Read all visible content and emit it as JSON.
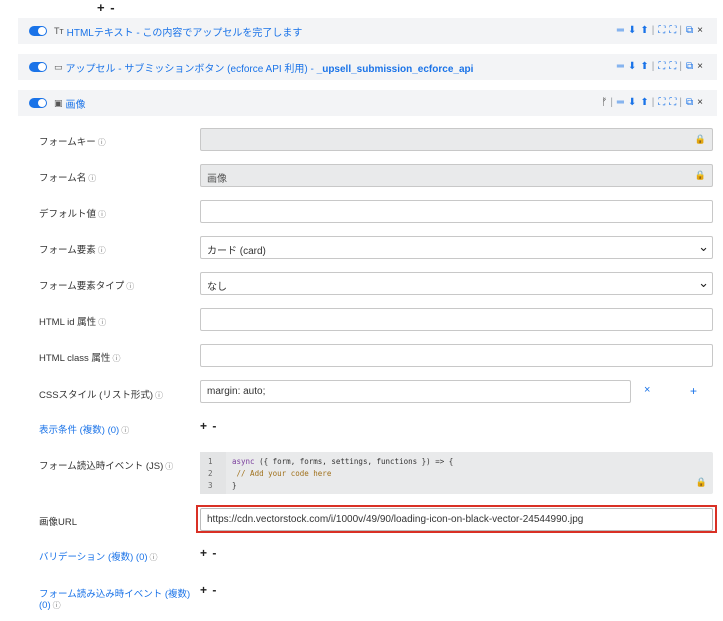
{
  "top_controls": "+ -",
  "blocks": [
    {
      "icon": "Tт",
      "title_prefix": "HTMLテキスト - この内容でアップセルを完了します",
      "title_bold": "",
      "tools": [
        "═",
        "⬇",
        "⬆",
        "|",
        "⛶",
        "⛶",
        "|",
        "⧉",
        "×"
      ]
    },
    {
      "icon": "▭",
      "title_prefix": "アップセル - サブミッションボタン (ecforce API 利用) - ",
      "title_bold": "_upsell_submission_ecforce_api",
      "tools": [
        "═",
        "⬇",
        "⬆",
        "|",
        "⛶",
        "⛶",
        "|",
        "⧉",
        "×"
      ]
    },
    {
      "icon": "▣",
      "title_prefix": "画像",
      "title_bold": "",
      "tools": [
        "ᚠ",
        "|",
        "═",
        "⬇",
        "⬆",
        "|",
        "⛶",
        "⛶",
        "|",
        "⧉",
        "×"
      ]
    }
  ],
  "fields": {
    "form_key": {
      "label": "フォームキー",
      "value": ""
    },
    "form_name": {
      "label": "フォーム名",
      "value": "画像"
    },
    "default_value": {
      "label": "デフォルト値",
      "value": ""
    },
    "form_element": {
      "label": "フォーム要素",
      "value": "カード (card)"
    },
    "form_element_type": {
      "label": "フォーム要素タイプ",
      "value": "なし"
    },
    "html_id": {
      "label": "HTML id 属性",
      "value": ""
    },
    "html_class": {
      "label": "HTML class 属性",
      "value": ""
    },
    "css_style": {
      "label": "CSSスタイル (リスト形式)",
      "value": "margin: auto;"
    },
    "display_condition": {
      "label": "表示条件 (複数) (0)",
      "controls": "+ -"
    },
    "on_load_event": {
      "label": "フォーム読込時イベント (JS)"
    },
    "image_url": {
      "label": "画像URL",
      "value": "https://cdn.vectorstock.com/i/1000v/49/90/loading-icon-on-black-vector-24544990.jpg"
    },
    "validation": {
      "label": "バリデーション (複数) (0)",
      "controls": "+ -"
    },
    "on_form_load_events": {
      "label_line1": "フォーム読み込み時イベント (複数)",
      "label_line2": "(0)",
      "controls": "+ -"
    }
  },
  "code": {
    "line_numbers": [
      "1",
      "2",
      "3"
    ],
    "line1_kw": "async",
    "line1_rest": " ({ form, forms, settings, functions }) => {",
    "line2": "  // Add your code here",
    "line3": "}"
  },
  "icons": {
    "info": "ⓘ",
    "lock": "🔒",
    "chevron": "⌄",
    "remove": "×",
    "add": "+"
  },
  "colors": {
    "accent": "#1a73e8",
    "highlight": "#d93025",
    "header_bg": "#f3f4f6",
    "disabled_bg": "#e9eaeb"
  }
}
